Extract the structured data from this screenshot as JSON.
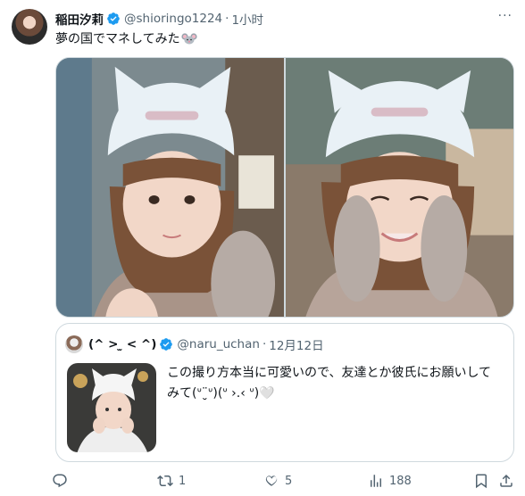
{
  "tweet": {
    "author_name": "稲田汐莉",
    "handle": "@shioringo1224",
    "separator": "·",
    "time": "1小时",
    "text": "夢の国でマネしてみた",
    "more_label": "···"
  },
  "quoted_tweet": {
    "author_name": "(^ > ̫ < ^)",
    "handle": "@naru_uchan",
    "separator": "·",
    "date": "12月12日",
    "text": "この撮り方本当に可愛いので、友達とか彼氏にお願いしてみて(ᐡ¨̮ᐡ)(ᐡ ›.‹ ᐡ)🤍"
  },
  "actions": {
    "reply_count": "",
    "retweet_count": "1",
    "like_count": "5",
    "views_count": "188"
  },
  "colors": {
    "verified": "#1d9bf0",
    "secondary_text": "#536471",
    "border": "#cfd9de"
  },
  "icons": [
    "verified-icon",
    "more-icon",
    "mouse-emoji",
    "reply-icon",
    "retweet-icon",
    "like-icon",
    "views-icon",
    "bookmark-icon",
    "share-icon"
  ]
}
